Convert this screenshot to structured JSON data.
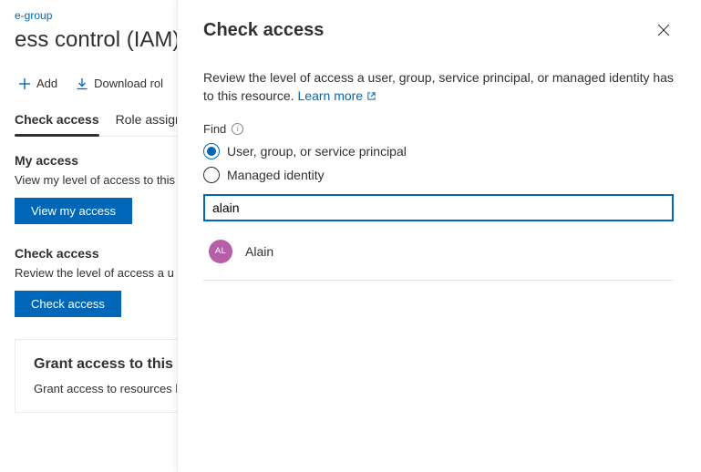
{
  "breadcrumb": "e-group",
  "page_heading": "ess control (IAM)",
  "toolbar": {
    "add_label": "Add",
    "download_label": "Download rol"
  },
  "tabs": {
    "check_access": "Check access",
    "role_assignments": "Role assign"
  },
  "my_access": {
    "title": "My access",
    "desc": "View my level of access to this",
    "button": "View my access"
  },
  "check_access": {
    "title": "Check access",
    "desc": "Review the level of access a u",
    "button": "Check access"
  },
  "grant_card": {
    "title": "Grant access to this re",
    "desc": "Grant access to resources b"
  },
  "panel": {
    "title": "Check access",
    "desc": "Review the level of access a user, group, service principal, or managed identity has to this resource. ",
    "learn_more": "Learn more",
    "find_label": "Find",
    "option_user": "User, group, or service principal",
    "option_managed": "Managed identity",
    "search_value": "alain",
    "result": {
      "initials": "AL",
      "name": "Alain"
    }
  }
}
